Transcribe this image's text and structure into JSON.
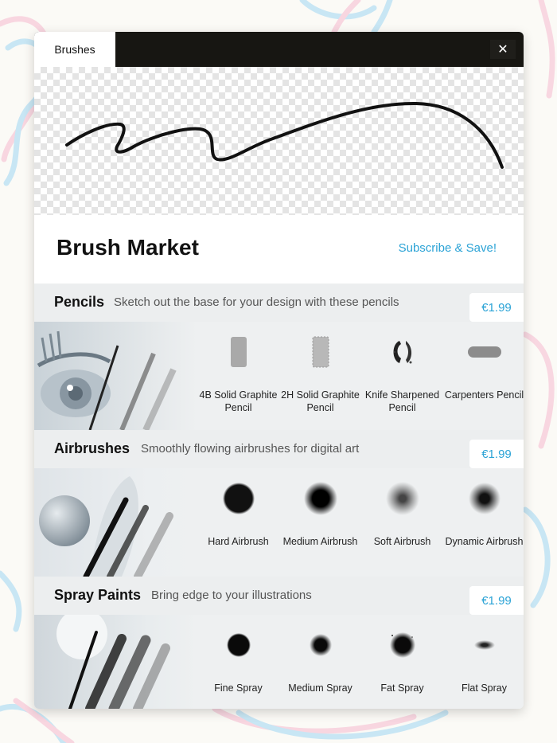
{
  "titlebar": {
    "tab_label": "Brushes",
    "close_icon": "close-icon",
    "close_glyph": "✕"
  },
  "market": {
    "title": "Brush Market",
    "subscribe_label": "Subscribe & Save!"
  },
  "colors": {
    "accent": "#2ba3d6",
    "titlebar": "#171612",
    "panel": "#eef0f1"
  },
  "sections": [
    {
      "name": "Pencils",
      "description": "Sketch out the base for your design with these pencils",
      "price": "€1.99",
      "brushes": [
        {
          "label": "4B Solid Graphite Pencil",
          "swatch": "pencil-4b-swatch"
        },
        {
          "label": "2H Solid Graphite Pencil",
          "swatch": "pencil-2h-swatch"
        },
        {
          "label": "Knife Sharpened Pencil",
          "swatch": "knife-pencil-swatch"
        },
        {
          "label": "Carpenters Pencil",
          "swatch": "carpenters-pencil-swatch"
        }
      ]
    },
    {
      "name": "Airbrushes",
      "description": "Smoothly flowing airbrushes for digital art",
      "price": "€1.99",
      "brushes": [
        {
          "label": "Hard Airbrush",
          "swatch": "hard-airbrush-swatch"
        },
        {
          "label": "Medium Airbrush",
          "swatch": "medium-airbrush-swatch"
        },
        {
          "label": "Soft Airbrush",
          "swatch": "soft-airbrush-swatch"
        },
        {
          "label": "Dynamic Airbrush",
          "swatch": "dynamic-airbrush-swatch"
        }
      ]
    },
    {
      "name": "Spray Paints",
      "description": "Bring edge to your illustrations",
      "price": "€1.99",
      "brushes": [
        {
          "label": "Fine Spray",
          "swatch": "fine-spray-swatch"
        },
        {
          "label": "Medium Spray",
          "swatch": "medium-spray-swatch"
        },
        {
          "label": "Fat Spray",
          "swatch": "fat-spray-swatch"
        },
        {
          "label": "Flat Spray",
          "swatch": "flat-spray-swatch"
        }
      ]
    }
  ]
}
